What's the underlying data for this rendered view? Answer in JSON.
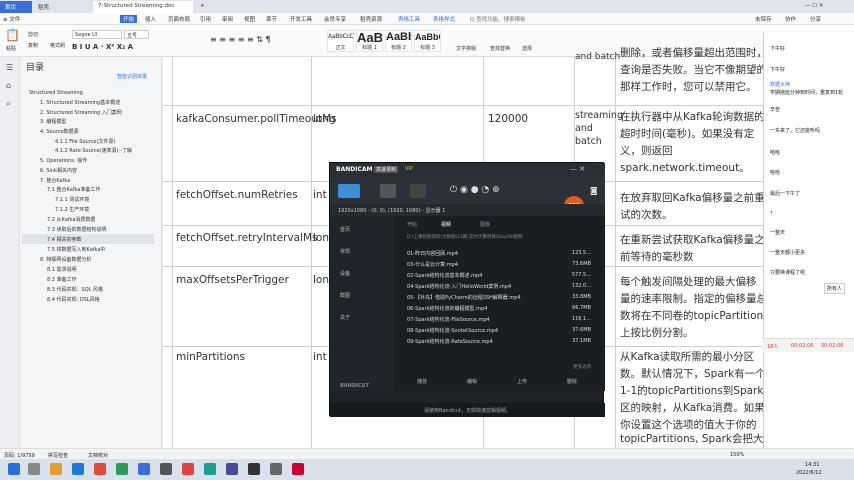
{
  "tabs": {
    "home": "首页",
    "wps": "稻壳",
    "doc": "7-Structured Streaming.doc",
    "add": "+"
  },
  "menu": {
    "file": "≡ 文件",
    "items": [
      "开始",
      "插入",
      "页面布局",
      "引用",
      "审阅",
      "视图",
      "章节",
      "开发工具",
      "会员专享",
      "稻壳资源",
      "表格工具",
      "表格样式"
    ],
    "search": "Q 查找功能、搜索模板",
    "right": [
      "未保存",
      "协作",
      "分享"
    ]
  },
  "ribbon": {
    "cut": "剪切",
    "copy": "复制",
    "paste": "粘贴",
    "format_painter": "格式刷",
    "font": "Segoe UI",
    "size": "五号",
    "styles": [
      {
        "preview": "AaBbCcDd",
        "name": "正文"
      },
      {
        "preview": "AaB",
        "name": "标题 1"
      },
      {
        "preview": "AaBb",
        "name": "标题 2"
      },
      {
        "preview": "AaBbC",
        "name": "标题 3"
      }
    ],
    "text_layout": "文字排版",
    "find_replace": "查找替换",
    "select": "选择"
  },
  "toc": {
    "title": "目录",
    "smart": "智能识别目录",
    "items": [
      "Structured Streaming",
      "1. Structured Streaming基本概述",
      "2. Structured Streaming 入门案例",
      "3. 编程模型",
      "4. Source数据源",
      "4.1.1 File Source(文件源)",
      "4.1.2 Rate Source(速率源)--了解",
      "5. Operations: 操作",
      "6. Sink相关内容",
      "7. 整合Kafka",
      "7.1 整合Kafka准备工作",
      "7.1.1 测试环境",
      "7.1.2 生产环境",
      "7.2 从Kafka消费数据",
      "7.3 读取后的数据结构说明",
      "7.4 相关的参数",
      "7.5 将数据写入到Kafka中",
      "8. 物联网设备数据分析",
      "8.1 需求说明",
      "8.2 准备工作",
      "8.3 代码实现：SQL 风格",
      "8.4 代码实现: DSL风格"
    ]
  },
  "table": {
    "rows": [
      {
        "name": "",
        "type": "",
        "default": "",
        "scope": "and batch",
        "desc": [
          "删除，或者偏移量超出范围时，",
          "查询是否失败。当它不像期望的",
          "那样工作时，您可以禁用它。"
        ]
      },
      {
        "name": "kafkaConsumer.pollTimeoutMs",
        "type": "long",
        "default": "120000",
        "scope": "streaming and batch",
        "desc": [
          "在执行器中从Kafka轮询数据的",
          "超时时间(毫秒)。如果没有定",
          "义，则返回",
          "spark.network.timeout。"
        ]
      },
      {
        "name": "fetchOffset.numRetries",
        "type": "int",
        "default": "",
        "scope": "",
        "desc": [
          "在放弃取回Kafka偏移量之前重",
          "试的次数。"
        ]
      },
      {
        "name": "fetchOffset.retryIntervalMs",
        "type": "long",
        "default": "",
        "scope": "",
        "desc": [
          "在重新尝试获取Kafka偏移量之",
          "前等待的毫秒数"
        ]
      },
      {
        "name": "maxOffsetsPerTrigger",
        "type": "long",
        "default": "",
        "scope": "",
        "desc": [
          "每个触发间隔处理的最大偏移",
          "量的速率限制。指定的偏移量总",
          "数将在不同卷的topicPartitions",
          "上按比例分割。"
        ]
      },
      {
        "name": "minPartitions",
        "type": "int",
        "default": "",
        "scope": "",
        "desc": [
          "从Kafka读取所需的最小分区",
          "数。默认情况下，Spark有一个",
          "1-1的topicPartitions到Spark分",
          "区的映射，从Kafka消费。如果",
          "你设置这个选项的值大于你的",
          "topicPartitions, Spark会把大的"
        ]
      }
    ]
  },
  "bandicam": {
    "logo": "BANDICAM",
    "badge": "高速录制",
    "vip": "VIP",
    "rec": "REC",
    "resolution": "1920x1080 - (0, 0), (1920, 1080) - 显示器 1",
    "tabs": [
      "开始",
      "视频",
      "图像"
    ],
    "side": [
      "首页",
      "常规",
      "设备",
      "截图",
      "关于"
    ],
    "path": "D:\\上课视频资料\\大数据\\23期-实时计算项目\\Day08\\视频",
    "files": [
      {
        "name": "01-昨日内容回顾.mp4",
        "size": "123.5..."
      },
      {
        "name": "03-什么是云计算.mp4",
        "size": "73.6MB"
      },
      {
        "name": "02-Spark结构化流基本概述.mp4",
        "size": "577.5..."
      },
      {
        "name": "04-Spark结构化流-入门HelloWorld案例.mp4",
        "size": "132.0..."
      },
      {
        "name": "05-【补充】借助PyCharm的远程SSH解释器.mp4",
        "size": "33.8MB"
      },
      {
        "name": "06-Spark结构化流的编程模型.mp4",
        "size": "66.7MB"
      },
      {
        "name": "07-Spark结构化流-FileSource.mp4",
        "size": "116.1..."
      },
      {
        "name": "08-Spark结构化流-SocketSource.mp4",
        "size": "37.6MB"
      },
      {
        "name": "09-Spark结构化流-RateSource.mp4",
        "size": "37.1MB"
      }
    ],
    "actions": [
      "播放",
      "编辑",
      "上传",
      "删除"
    ],
    "bandicut": "BANDICUT",
    "more": "更多选项",
    "footer": "请使用Bandicut，无损快速剪辑视频。"
  },
  "chat": {
    "messages": [
      {
        "user": "",
        "text": "下午好"
      },
      {
        "user": "",
        "text": "下午好"
      },
      {
        "user": "数据大神",
        "text": "学期拖延分钟到时间，重复到1轮"
      },
      {
        "user": "",
        "text": "辛苦"
      },
      {
        "user": "",
        "text": "一东来了，它还能听吗"
      },
      {
        "user": "",
        "text": "哈哈"
      },
      {
        "user": "",
        "text": "哈哈"
      },
      {
        "user": "",
        "text": "最后一下午了"
      },
      {
        "user": "",
        "text": "？"
      },
      {
        "user": "",
        "text": "一整天"
      },
      {
        "user": "",
        "text": "一整天都小更多"
      },
      {
        "user": "",
        "text": "只要换课程了呢"
      }
    ],
    "all": "所有人",
    "stats": [
      "18人",
      "00:02:06",
      "00:02:06"
    ]
  },
  "status": {
    "page": "页码: 1/9759",
    "spell": "拼写检查",
    "align": "文档校对",
    "zoom": "150%"
  },
  "taskbar": {
    "time": "14:31",
    "date": "2022/6/12"
  },
  "colors": {
    "accent": "#3b6fd8",
    "rec": "#e85a22",
    "bandicam_bg": "#1f2329"
  }
}
